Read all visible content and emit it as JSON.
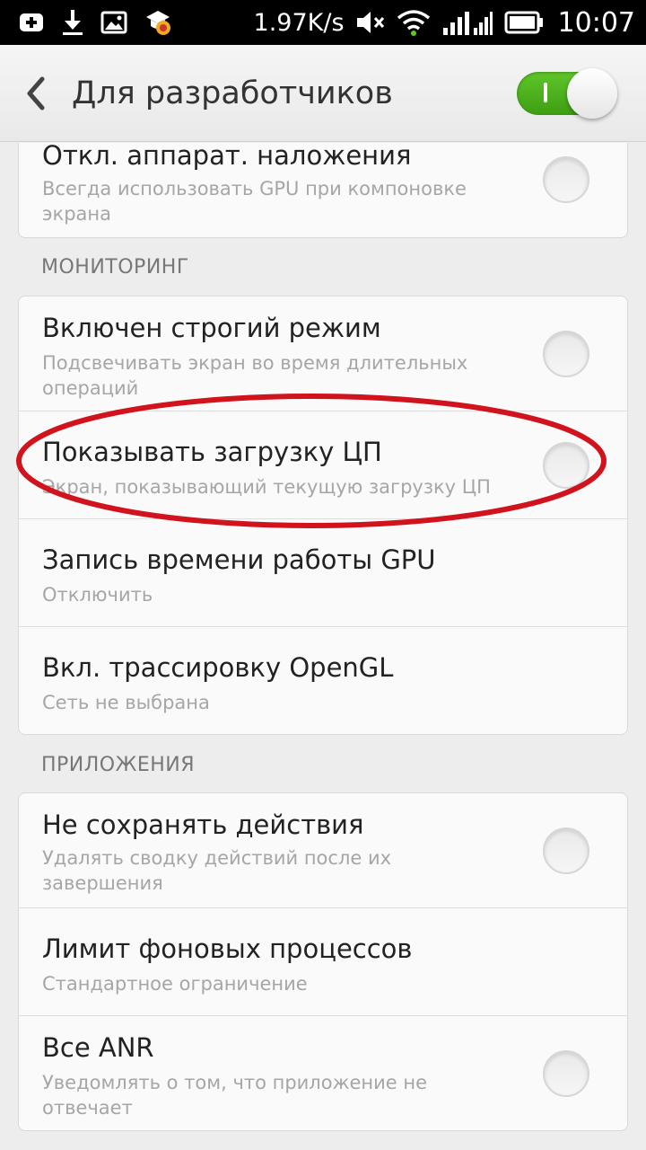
{
  "status_bar": {
    "speed": "1.97K/s",
    "time": "10:07",
    "icons": [
      "add-notification-icon",
      "download-icon",
      "image-icon",
      "app-badge-icon",
      "mute-icon",
      "wifi-icon",
      "signal-icon",
      "battery-icon"
    ]
  },
  "action_bar": {
    "title": "Для разработчиков",
    "toggle_on": true,
    "toggle_color": "#4caf1e"
  },
  "card1": {
    "rows": [
      {
        "title": "Откл. аппарат. наложения",
        "subtitle": "Всегда использовать GPU при компоновке экрана",
        "checked": false
      }
    ]
  },
  "sections": [
    {
      "header": "МОНИТОРИНГ",
      "rows": [
        {
          "title": "Включен строгий режим",
          "subtitle": "Подсвечивать экран во время длительных операций",
          "checked": false
        },
        {
          "title": "Показывать загрузку ЦП",
          "subtitle": "Экран, показывающий текущую загрузку ЦП",
          "checked": false,
          "highlighted": true
        },
        {
          "title": "Запись времени работы GPU",
          "subtitle": "Отключить"
        },
        {
          "title": "Вкл. трассировку OpenGL",
          "subtitle": "Сеть не выбрана"
        }
      ]
    },
    {
      "header": "ПРИЛОЖЕНИЯ",
      "rows": [
        {
          "title": "Не сохранять действия",
          "subtitle": "Удалять сводку действий после их завершения",
          "checked": false
        },
        {
          "title": "Лимит фоновых процессов",
          "subtitle": "Стандартное ограничение"
        },
        {
          "title": "Все ANR",
          "subtitle": "Уведомлять о том, что приложение не отвечает",
          "checked": false
        }
      ]
    }
  ],
  "colors": {
    "highlight_ellipse": "#d0131c",
    "background": "#ededed"
  }
}
